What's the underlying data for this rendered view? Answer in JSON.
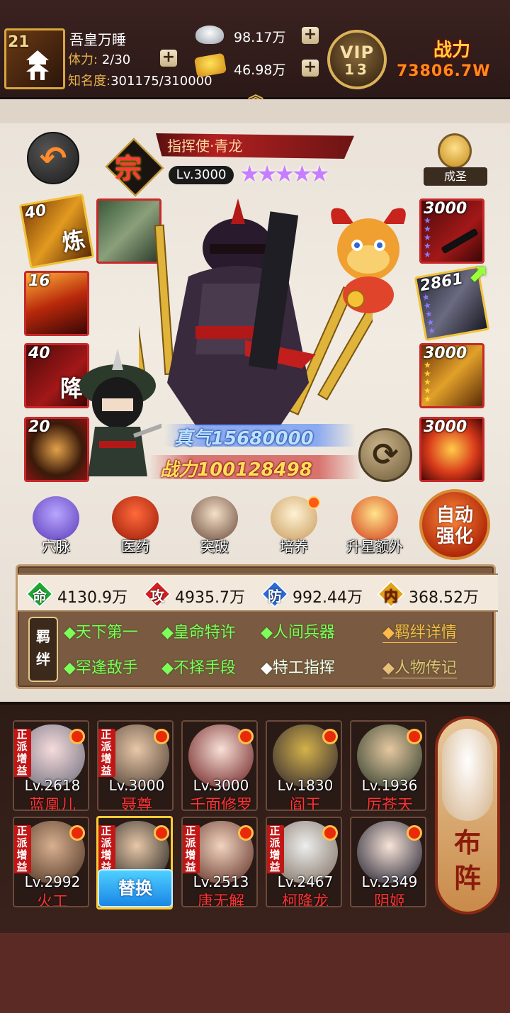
{
  "player": {
    "level": "21",
    "name": "吾皇万睡",
    "stamina_label": "体力:",
    "stamina_value": "2/30",
    "fame_label": "知名度:",
    "fame_value": "301175/310000"
  },
  "currency": {
    "silver": "98.17万",
    "gold": "46.98万"
  },
  "vip": {
    "label": "VIP",
    "level": "13"
  },
  "power": {
    "label": "战力",
    "value": "73806.7W"
  },
  "hero": {
    "grade": "宗",
    "title": "指挥使·青龙",
    "level": "Lv.3000",
    "stars": "★★★★★",
    "rank_label": "成圣",
    "zhenqi": "真气15680000",
    "zhanli": "战力100128498"
  },
  "left_slots": [
    {
      "num": "40",
      "glyph": "炼",
      "icon": "refine-icon"
    },
    {
      "num": "",
      "glyph": "",
      "icon": "general-portrait"
    },
    {
      "num": "16",
      "glyph": "",
      "icon": "skill-icon"
    },
    {
      "num": "40",
      "glyph": "降",
      "icon": "subdue-icon"
    },
    {
      "num": "20",
      "glyph": "",
      "icon": "orb-icon"
    }
  ],
  "right_slots": [
    {
      "num": "3000",
      "icon": "weapon-icon"
    },
    {
      "num": "2861",
      "icon": "armor-icon"
    },
    {
      "num": "3000",
      "icon": "treasure-icon"
    },
    {
      "num": "3000",
      "icon": "dragon-icon"
    }
  ],
  "functions": [
    {
      "label": "穴脉",
      "icon": "meridian-icon"
    },
    {
      "label": "医药",
      "icon": "medicine-icon"
    },
    {
      "label": "突破",
      "icon": "breakthrough-icon"
    },
    {
      "label": "培养",
      "icon": "train-icon"
    },
    {
      "label": "升星额外",
      "icon": "star-up-icon"
    }
  ],
  "auto_strengthen": {
    "line1": "自动",
    "line2": "强化"
  },
  "stats": [
    {
      "glyph": "命",
      "value": "4130.9万",
      "color": "#1ea832"
    },
    {
      "glyph": "攻",
      "value": "4935.7万",
      "color": "#d2201e"
    },
    {
      "glyph": "防",
      "value": "992.44万",
      "color": "#2a6ad6"
    },
    {
      "glyph": "内",
      "value": "368.52万",
      "color": "#e2a21a"
    }
  ],
  "bond": {
    "label": "羁绊",
    "tags": [
      "◆天下第一",
      "◆皇命特许",
      "◆人间兵器",
      "◆罕逢敌手",
      "◆不择手段",
      "◆特工指挥"
    ],
    "details": "◆羁绊详情",
    "biography": "◆人物传记"
  },
  "team": [
    {
      "level": "Lv.2618",
      "name": "蓝凰儿",
      "badge": "正派增益"
    },
    {
      "level": "Lv.3000",
      "name": "聂尊",
      "badge": "正派增益"
    },
    {
      "level": "Lv.3000",
      "name": "千面修罗",
      "badge": ""
    },
    {
      "level": "Lv.1830",
      "name": "阎王",
      "badge": ""
    },
    {
      "level": "Lv.1936",
      "name": "厉苍天",
      "badge": ""
    },
    {
      "level": "Lv.2992",
      "name": "火工",
      "badge": "正派增益"
    },
    {
      "level": "",
      "name": "",
      "badge": "正派增益"
    },
    {
      "level": "Lv.2513",
      "name": "唐无解",
      "badge": "正派增益"
    },
    {
      "level": "Lv.2467",
      "name": "柯降龙",
      "badge": "正派增益"
    },
    {
      "level": "Lv.2349",
      "name": "阴姬",
      "badge": ""
    }
  ],
  "replace_label": "替换",
  "formation_label": "布阵"
}
